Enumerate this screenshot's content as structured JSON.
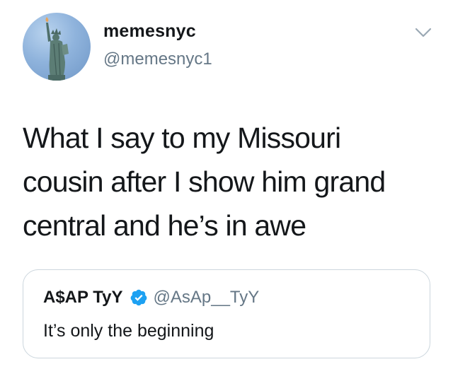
{
  "tweet": {
    "display_name": "memesnyc",
    "handle": "@memesnyc1",
    "avatar_icon": "statue-of-liberty-avatar",
    "menu_icon": "chevron-down-icon",
    "text": "What I say to my Missouri\ncousin after I show him grand\ncentral and he’s in awe"
  },
  "quoted_tweet": {
    "display_name": "A$AP TyY",
    "verified": true,
    "verified_icon": "verified-badge-icon",
    "handle": "@AsAp__TyY",
    "text": "It’s only the beginning"
  },
  "colors": {
    "text_primary": "#14171a",
    "text_secondary": "#657786",
    "verified_blue": "#1da1f2",
    "border": "#ccd6dd"
  }
}
